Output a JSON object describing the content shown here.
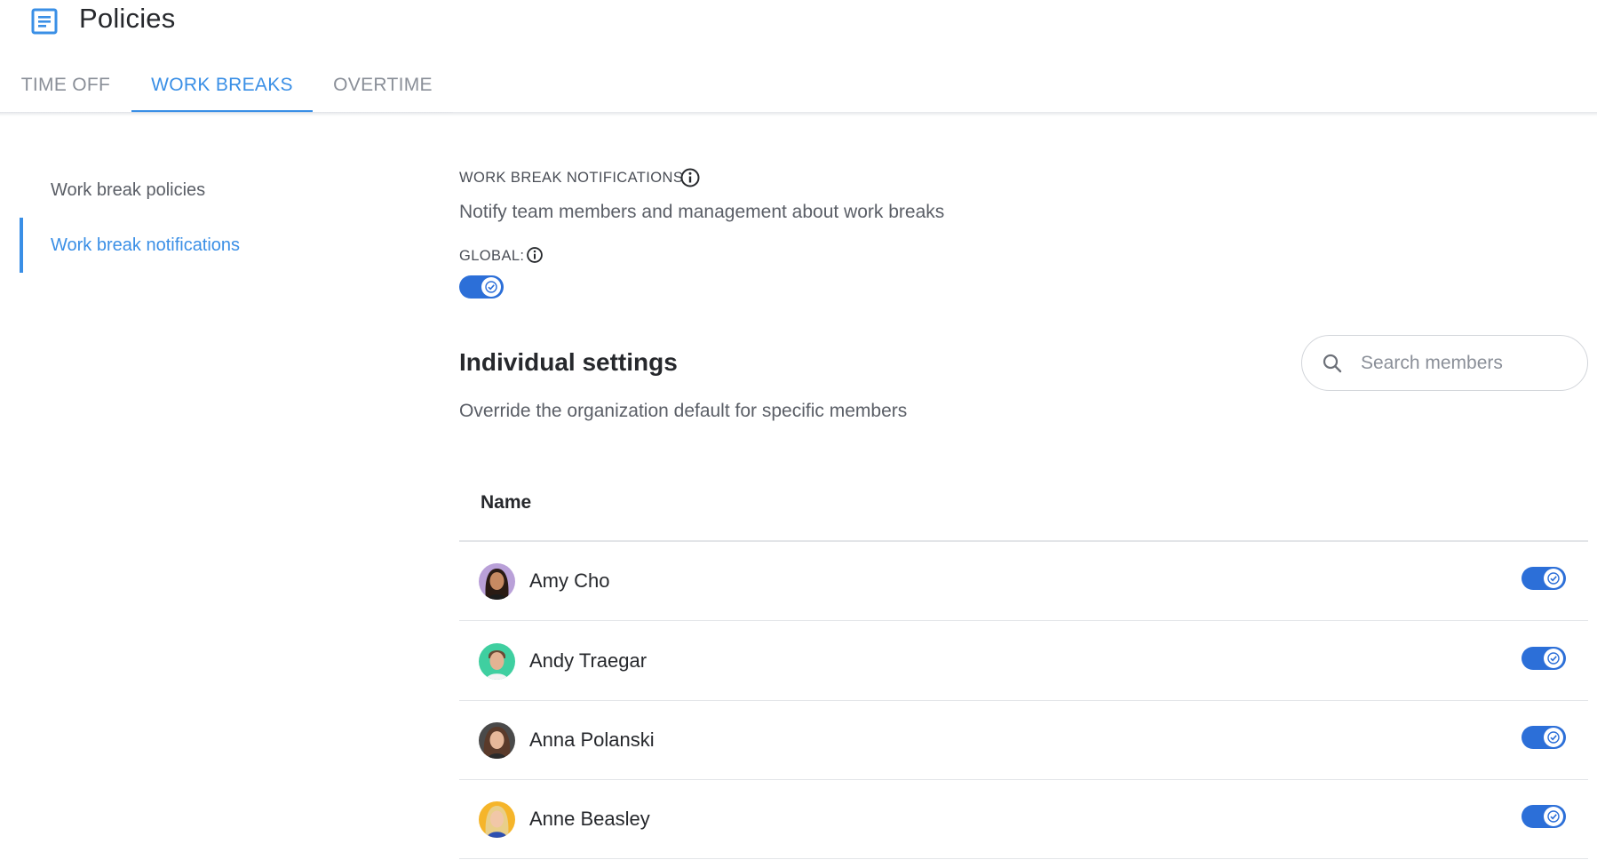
{
  "header": {
    "title": "Policies",
    "tabs": [
      {
        "label": "TIME OFF",
        "active": false
      },
      {
        "label": "WORK BREAKS",
        "active": true
      },
      {
        "label": "OVERTIME",
        "active": false
      }
    ]
  },
  "sidebar": {
    "items": [
      {
        "label": "Work break policies",
        "active": false
      },
      {
        "label": "Work break notifications",
        "active": true
      }
    ]
  },
  "main": {
    "section_label": "WORK BREAK NOTIFICATIONS",
    "section_desc": "Notify team members and management about work breaks",
    "global_label": "GLOBAL:",
    "global_enabled": true,
    "individual_title": "Individual settings",
    "individual_desc": "Override the organization default for specific members",
    "search_placeholder": "Search members",
    "table_header": "Name",
    "members": [
      {
        "name": "Amy Cho",
        "enabled": true
      },
      {
        "name": "Andy Traegar",
        "enabled": true
      },
      {
        "name": "Anna Polanski",
        "enabled": true
      },
      {
        "name": "Anne Beasley",
        "enabled": true
      }
    ]
  },
  "colors": {
    "accent": "#3a8fe6",
    "toggle_on": "#2c6fd8",
    "text_primary": "#26282c",
    "text_secondary": "#5a5e66"
  },
  "icons": [
    "document-icon",
    "info-icon",
    "search-icon",
    "check-icon",
    "avatar"
  ]
}
